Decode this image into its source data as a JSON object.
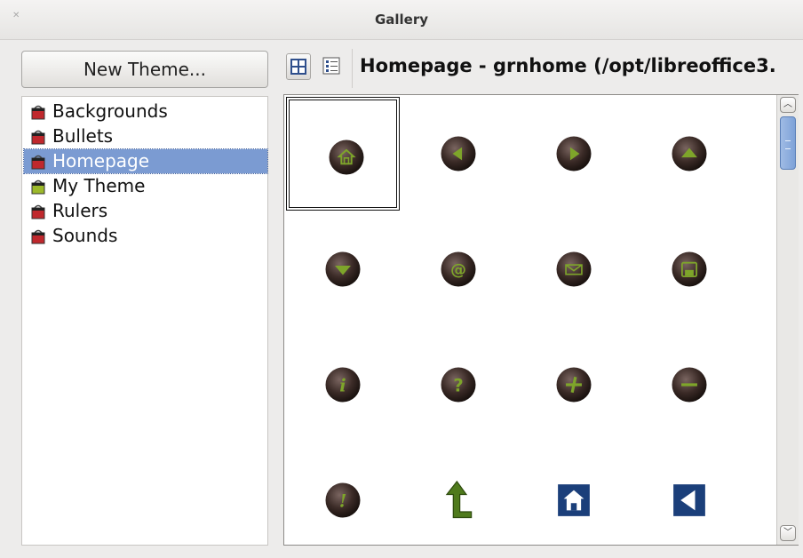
{
  "window": {
    "title": "Gallery"
  },
  "toolbar": {
    "new_theme_label": "New Theme...",
    "icon_view_icon": "icon-view-icon",
    "detail_view_icon": "detail-view-icon",
    "current_theme_path": "Homepage - grnhome (/opt/libreoffice3."
  },
  "themes": [
    {
      "label": "Backgrounds",
      "icon": "bucket-icon",
      "color": "#c0282d",
      "selected": false
    },
    {
      "label": "Bullets",
      "icon": "bucket-icon",
      "color": "#c0282d",
      "selected": false
    },
    {
      "label": "Homepage",
      "icon": "bucket-icon",
      "color": "#c0282d",
      "selected": true
    },
    {
      "label": "My Theme",
      "icon": "bucket-icon",
      "color": "#9cb92a",
      "selected": false
    },
    {
      "label": "Rulers",
      "icon": "bucket-icon",
      "color": "#c0282d",
      "selected": false
    },
    {
      "label": "Sounds",
      "icon": "bucket-icon",
      "color": "#c0282d",
      "selected": false
    }
  ],
  "gallery_items": [
    {
      "icon": "home-button-icon",
      "selected": true
    },
    {
      "icon": "arrow-left-button-icon",
      "selected": false
    },
    {
      "icon": "arrow-right-button-icon",
      "selected": false
    },
    {
      "icon": "arrow-up-button-icon",
      "selected": false
    },
    {
      "icon": "arrow-down-button-icon",
      "selected": false
    },
    {
      "icon": "at-sign-button-icon",
      "selected": false
    },
    {
      "icon": "mail-button-icon",
      "selected": false
    },
    {
      "icon": "disk-button-icon",
      "selected": false
    },
    {
      "icon": "info-button-icon",
      "selected": false
    },
    {
      "icon": "question-button-icon",
      "selected": false
    },
    {
      "icon": "plus-button-icon",
      "selected": false
    },
    {
      "icon": "minus-button-icon",
      "selected": false
    },
    {
      "icon": "exclamation-button-icon",
      "selected": false
    },
    {
      "icon": "up-turn-arrow-icon",
      "selected": false
    },
    {
      "icon": "blue-home-icon",
      "selected": false
    },
    {
      "icon": "blue-left-arrow-icon",
      "selected": false
    }
  ],
  "colors": {
    "accent": "#7b9bd2",
    "button_green": "#6f8f1c",
    "button_dark": "#3a2a26"
  }
}
